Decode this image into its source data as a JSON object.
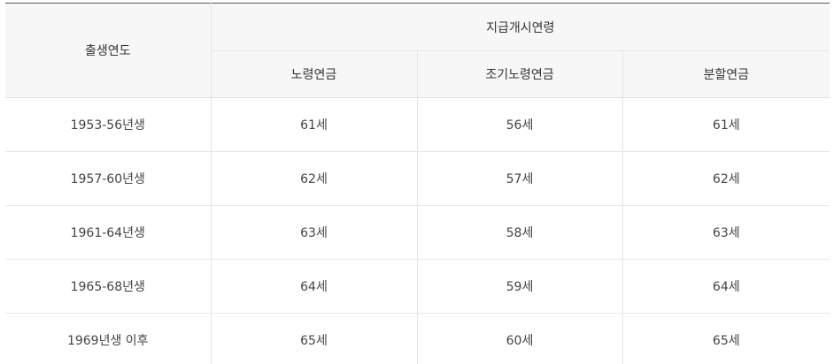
{
  "table": {
    "row_header": "출생연도",
    "group_header": "지급개시연령",
    "columns": [
      "노령연금",
      "조기노령연금",
      "분할연금"
    ],
    "rows": [
      {
        "year": "1953-56년생",
        "values": [
          "61세",
          "56세",
          "61세"
        ]
      },
      {
        "year": "1957-60년생",
        "values": [
          "62세",
          "57세",
          "62세"
        ]
      },
      {
        "year": "1961-64년생",
        "values": [
          "63세",
          "58세",
          "63세"
        ]
      },
      {
        "year": "1965-68년생",
        "values": [
          "64세",
          "59세",
          "64세"
        ]
      },
      {
        "year": "1969년생 이후",
        "values": [
          "65세",
          "60세",
          "65세"
        ]
      }
    ]
  },
  "colors": {
    "header_bg": "#f7f7f7",
    "top_border": "#555555",
    "grid_line": "#e3e3e3",
    "text": "#333333"
  }
}
